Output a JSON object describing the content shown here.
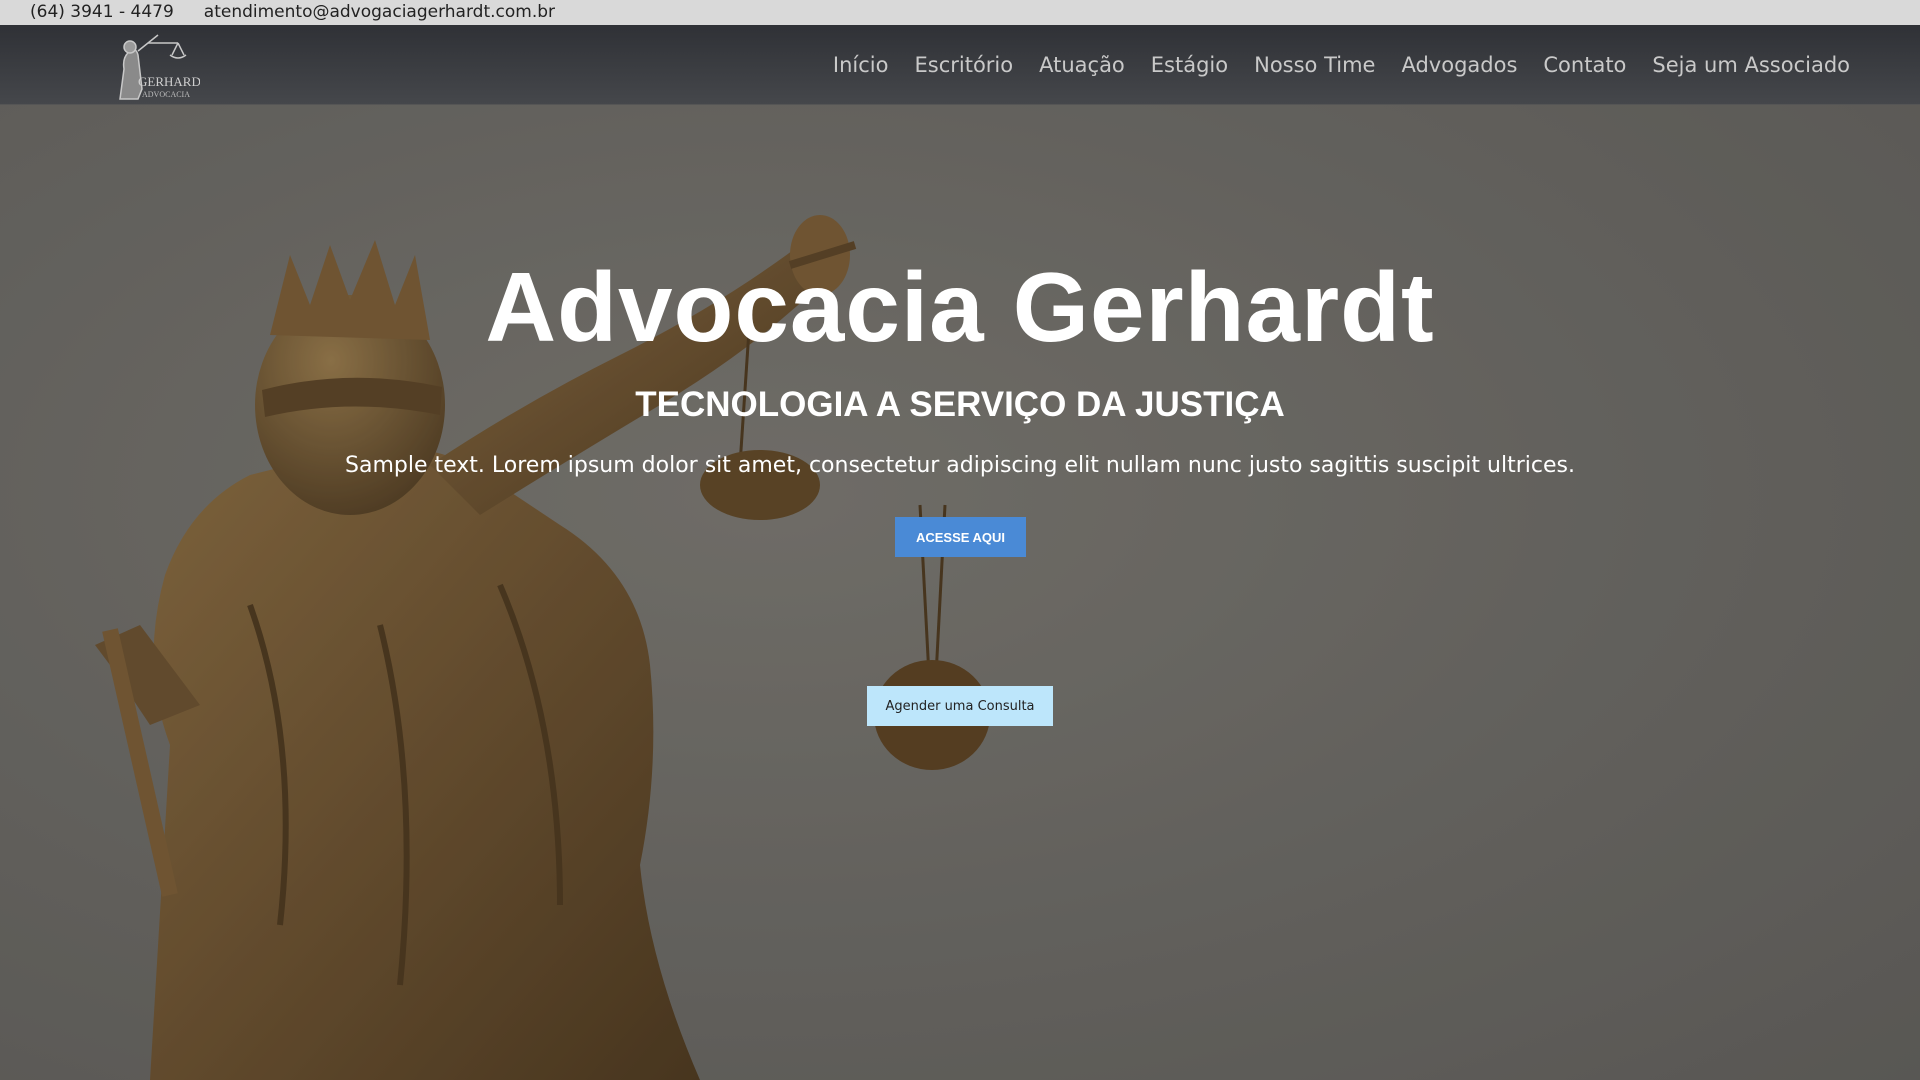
{
  "topbar": {
    "phone": "(64) 3941 - 4479",
    "email": "atendimento@advogaciagerhardt.com.br"
  },
  "header": {
    "logo_text": "GERHARDT",
    "logo_subtext": "ADVOCACIA",
    "nav": [
      {
        "label": "Início"
      },
      {
        "label": "Escritório"
      },
      {
        "label": "Atuação"
      },
      {
        "label": "Estágio"
      },
      {
        "label": "Nosso Time"
      },
      {
        "label": "Advogados"
      },
      {
        "label": "Contato"
      },
      {
        "label": "Seja um Associado"
      }
    ]
  },
  "hero": {
    "title": "Advocacia Gerhardt",
    "subtitle": "TECNOLOGIA A SERVIÇO DA JUSTIÇA",
    "text": "Sample text. Lorem ipsum dolor sit amet, consectetur adipiscing elit nullam nunc justo sagittis suscipit ultrices.",
    "primary_button": "ACESSE AQUI",
    "secondary_button": "Agender uma Consulta",
    "image": "lady-justice-statue"
  },
  "colors": {
    "topbar_bg": "#d9d9d9",
    "header_bg": "#3a3c40",
    "primary_button": "#4a8ad6",
    "secondary_button": "#bde6fb",
    "nav_text": "#c9c9c9"
  }
}
